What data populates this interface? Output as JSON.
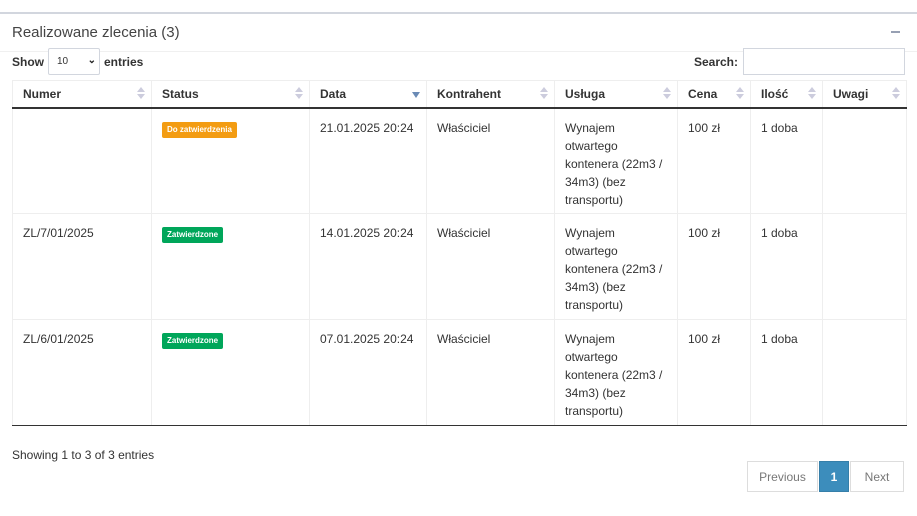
{
  "box": {
    "title": "Realizowane zlecenia (3)"
  },
  "controls": {
    "show_label": "Show",
    "entries_label": "entries",
    "length_value": "10",
    "search_label": "Search:",
    "search_value": ""
  },
  "table": {
    "headers": [
      "Numer",
      "Status",
      "Data",
      "Kontrahent",
      "Usługa",
      "Cena",
      "Ilość",
      "Uwagi"
    ],
    "sorted_column": "Data",
    "sort_direction": "desc",
    "rows": [
      {
        "numer": "",
        "status": "Do zatwierdzenia",
        "status_color": "#f39c12",
        "data": "21.01.2025 20:24",
        "kontrahent": "Właściciel",
        "usluga": "Wynajem otwartego kontenera (22m3 / 34m3) (bez transportu)",
        "cena": "100 zł",
        "ilosc": "1 doba",
        "uwagi": ""
      },
      {
        "numer": "ZL/7/01/2025",
        "status": "Zatwierdzone",
        "status_color": "#00a65a",
        "data": "14.01.2025 20:24",
        "kontrahent": "Właściciel",
        "usluga": "Wynajem otwartego kontenera (22m3 / 34m3) (bez transportu)",
        "cena": "100 zł",
        "ilosc": "1 doba",
        "uwagi": ""
      },
      {
        "numer": "ZL/6/01/2025",
        "status": "Zatwierdzone",
        "status_color": "#00a65a",
        "data": "07.01.2025 20:24",
        "kontrahent": "Właściciel",
        "usluga": "Wynajem otwartego kontenera (22m3 / 34m3) (bez transportu)",
        "cena": "100 zł",
        "ilosc": "1 doba",
        "uwagi": ""
      }
    ]
  },
  "footer": {
    "info": "Showing 1 to 3 of 3 entries",
    "previous": "Previous",
    "current_page": "1",
    "next": "Next"
  },
  "colors": {
    "accent": "#3c8dbc",
    "warning": "#f39c12",
    "success": "#00a65a"
  }
}
